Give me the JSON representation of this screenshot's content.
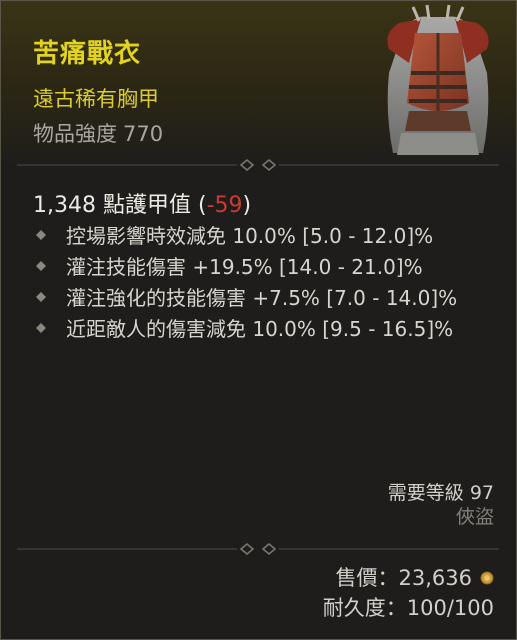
{
  "item": {
    "name": "苦痛戰衣",
    "type": "遠古稀有胸甲",
    "power_label": "物品強度",
    "power_value": "770"
  },
  "armor": {
    "value": "1,348",
    "label": "點護甲值",
    "delta_open": "(",
    "delta": "-59",
    "delta_close": ")"
  },
  "affixes": [
    {
      "text": "控場影響時效減免 10.0% [5.0 - 12.0]%"
    },
    {
      "text": "灌注技能傷害 +19.5% [14.0 - 21.0]%"
    },
    {
      "text": "灌注強化的技能傷害 +7.5% [7.0 - 14.0]%"
    },
    {
      "text": "近距敵人的傷害減免 10.0% [9.5 - 16.5]%"
    }
  ],
  "requirements": {
    "level_label": "需要等級",
    "level_value": "97",
    "class": "俠盜"
  },
  "footer": {
    "sell_label": "售價：",
    "sell_value": "23,636",
    "durability_label": "耐久度：",
    "durability_value": "100/100"
  },
  "colors": {
    "rare_name": "#e2d321",
    "rare_type": "#dccd2e",
    "negative": "#c83b34",
    "gold": "#c89b3a"
  },
  "icons": {
    "item_image": "chest-armor-icon",
    "bullet": "affix-diamond-icon",
    "currency": "gold-coin-icon"
  }
}
